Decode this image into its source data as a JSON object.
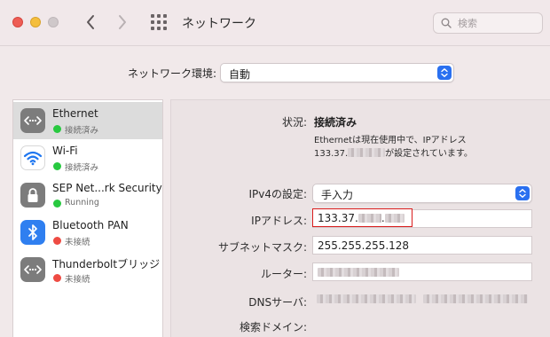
{
  "window": {
    "title": "ネットワーク",
    "search": {
      "placeholder": "検索",
      "value": ""
    }
  },
  "location": {
    "label": "ネットワーク環境:",
    "value": "自動"
  },
  "services": [
    {
      "name": "Ethernet",
      "status": "接続済み",
      "status_color": "#28c940",
      "icon": "ethernet-icon",
      "selected": true
    },
    {
      "name": "Wi-Fi",
      "status": "接続済み",
      "status_color": "#28c940",
      "icon": "wifi-icon",
      "selected": false
    },
    {
      "name": "SEP Net...rk Security",
      "status": "Running",
      "status_color": "#28c940",
      "icon": "lock-icon",
      "selected": false
    },
    {
      "name": "Bluetooth PAN",
      "status": "未接続",
      "status_color": "#ee4b43",
      "icon": "bluetooth-icon",
      "selected": false
    },
    {
      "name": "Thunderboltブリッジ",
      "status": "未接続",
      "status_color": "#ee4b43",
      "icon": "thunderbolt-bridge-icon",
      "selected": false
    }
  ],
  "detail": {
    "status_label": "状況:",
    "status_value": "接続済み",
    "description_line1": "Ethernetは現在使用中で、IPアドレス",
    "description_prefix": "133.37.",
    "description_suffix": "が設定されています。",
    "ipv4_label": "IPv4の設定:",
    "ipv4_value": "手入力",
    "ip_label": "IPアドレス:",
    "ip_prefix": "133.37.",
    "ip_dot": ".",
    "subnet_label": "サブネットマスク:",
    "subnet_value": "255.255.255.128",
    "router_label": "ルーター:",
    "dns_label": "DNSサーバ:",
    "search_domain_label": "検索ドメイン:"
  },
  "colors": {
    "accent": "#2a70f0",
    "connected": "#28c940",
    "disconnected": "#ee4b43",
    "highlight_box": "#d91d1d"
  }
}
